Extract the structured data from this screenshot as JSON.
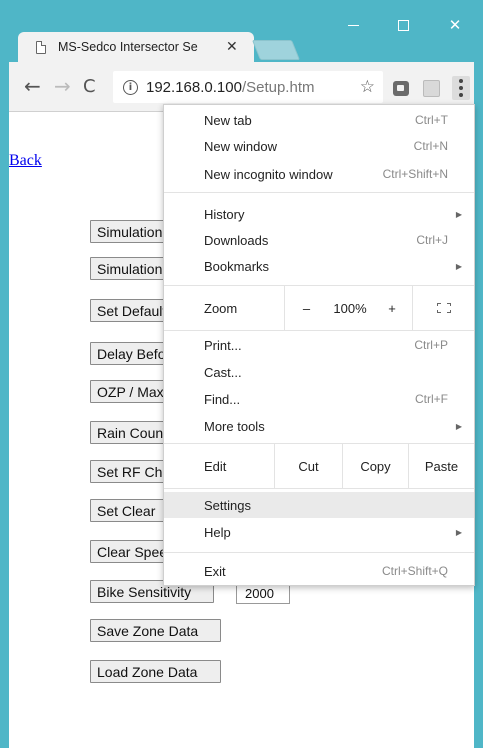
{
  "window": {
    "minimize_icon": "minimize-icon",
    "maximize_icon": "maximize-icon",
    "close_glyph": "✕"
  },
  "tab": {
    "title": "MS-Sedco Intersector Se",
    "close_glyph": "✕"
  },
  "toolbar": {
    "back_glyph": "←",
    "forward_glyph": "→",
    "reload_glyph": "C",
    "info_glyph": "i",
    "url_host": "192.168.0.100",
    "url_path": "/Setup.htm",
    "star_glyph": "☆"
  },
  "page": {
    "back_link": "Back",
    "buttons": [
      "Simulation",
      "Simulation",
      "Set Default",
      "Delay Before",
      "OZP / Max",
      "Rain Count",
      "Set RF Channel",
      "Set Clear",
      "Clear Speed",
      "Bike Sensitivity",
      "Save Zone Data",
      "Load Zone Data"
    ],
    "bike_sensitivity_value": "2000"
  },
  "menu": {
    "new_tab": {
      "label": "New tab",
      "shortcut": "Ctrl+T"
    },
    "new_window": {
      "label": "New window",
      "shortcut": "Ctrl+N"
    },
    "new_incognito": {
      "label": "New incognito window",
      "shortcut": "Ctrl+Shift+N"
    },
    "history": {
      "label": "History"
    },
    "downloads": {
      "label": "Downloads",
      "shortcut": "Ctrl+J"
    },
    "bookmarks": {
      "label": "Bookmarks"
    },
    "zoom": {
      "label": "Zoom",
      "minus": "–",
      "value": "100%",
      "plus": "+"
    },
    "print": {
      "label": "Print...",
      "shortcut": "Ctrl+P"
    },
    "cast": {
      "label": "Cast..."
    },
    "find": {
      "label": "Find...",
      "shortcut": "Ctrl+F"
    },
    "more_tools": {
      "label": "More tools"
    },
    "edit": {
      "label": "Edit",
      "cut": "Cut",
      "copy": "Copy",
      "paste": "Paste"
    },
    "settings": {
      "label": "Settings"
    },
    "help": {
      "label": "Help"
    },
    "exit": {
      "label": "Exit",
      "shortcut": "Ctrl+Shift+Q"
    },
    "submenu_arrow": "▶"
  },
  "colors": {
    "frame": "#4fb6c7",
    "link": "#0000ee",
    "menu_highlight": "#eaeaea"
  }
}
